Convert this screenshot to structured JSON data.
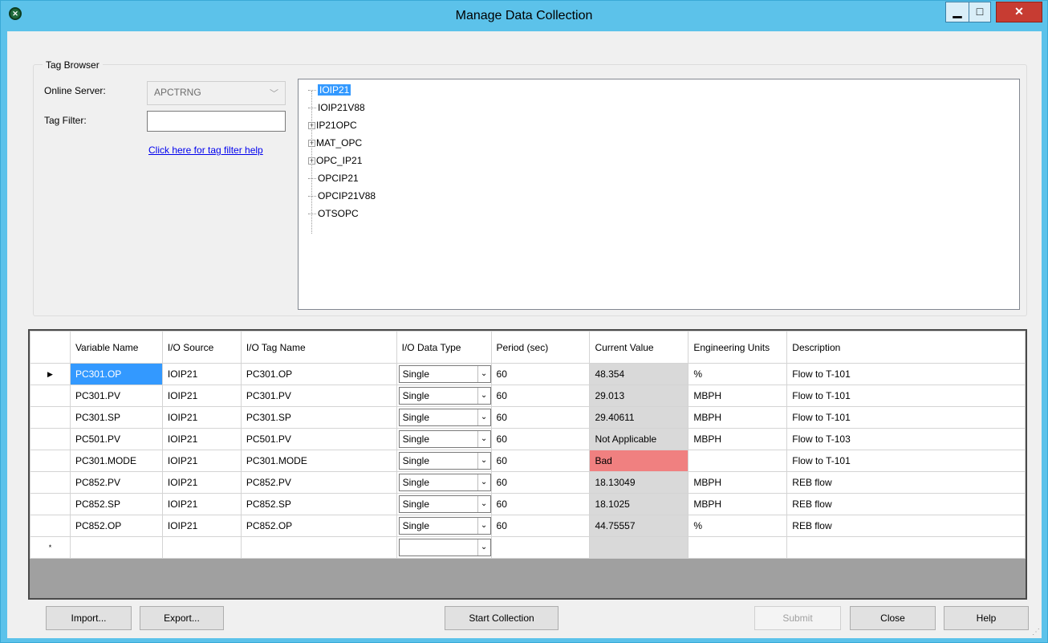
{
  "window": {
    "title": "Manage Data Collection",
    "icon_name": "app-icon"
  },
  "tag_browser": {
    "group_title": "Tag Browser",
    "online_server_label": "Online Server:",
    "online_server_value": "APCTRNG",
    "tag_filter_label": "Tag Filter:",
    "tag_filter_value": "",
    "help_link": "Click here for tag filter help",
    "tree": [
      {
        "label": "IOIP21",
        "expandable": false,
        "selected": true
      },
      {
        "label": "IOIP21V88",
        "expandable": false,
        "selected": false
      },
      {
        "label": "IP21OPC",
        "expandable": true,
        "selected": false
      },
      {
        "label": "MAT_OPC",
        "expandable": true,
        "selected": false
      },
      {
        "label": "OPC_IP21",
        "expandable": true,
        "selected": false
      },
      {
        "label": "OPCIP21",
        "expandable": false,
        "selected": false
      },
      {
        "label": "OPCIP21V88",
        "expandable": false,
        "selected": false
      },
      {
        "label": "OTSOPC",
        "expandable": false,
        "selected": false
      }
    ]
  },
  "grid": {
    "columns": [
      "Variable Name",
      "I/O Source",
      "I/O Tag Name",
      "I/O Data Type",
      "Period (sec)",
      "Current Value",
      "Engineering Units",
      "Description"
    ],
    "rows": [
      {
        "var": "PC301.OP",
        "src": "IOIP21",
        "tag": "PC301.OP",
        "type": "Single",
        "period": "60",
        "value": "48.354",
        "units": "%",
        "desc": "Flow to T-101",
        "status": "ok"
      },
      {
        "var": "PC301.PV",
        "src": "IOIP21",
        "tag": "PC301.PV",
        "type": "Single",
        "period": "60",
        "value": "29.013",
        "units": "MBPH",
        "desc": "Flow to T-101",
        "status": "ok"
      },
      {
        "var": "PC301.SP",
        "src": "IOIP21",
        "tag": "PC301.SP",
        "type": "Single",
        "period": "60",
        "value": "29.40611",
        "units": "MBPH",
        "desc": "Flow to T-101",
        "status": "ok"
      },
      {
        "var": "PC501.PV",
        "src": "IOIP21",
        "tag": "PC501.PV",
        "type": "Single",
        "period": "60",
        "value": "Not Applicable",
        "units": "MBPH",
        "desc": "Flow to T-103",
        "status": "ok"
      },
      {
        "var": "PC301.MODE",
        "src": "IOIP21",
        "tag": "PC301.MODE",
        "type": "Single",
        "period": "60",
        "value": "Bad",
        "units": "",
        "desc": "Flow to T-101",
        "status": "bad"
      },
      {
        "var": "PC852.PV",
        "src": "IOIP21",
        "tag": "PC852.PV",
        "type": "Single",
        "period": "60",
        "value": "18.13049",
        "units": "MBPH",
        "desc": "REB flow",
        "status": "ok"
      },
      {
        "var": "PC852.SP",
        "src": "IOIP21",
        "tag": "PC852.SP",
        "type": "Single",
        "period": "60",
        "value": "18.1025",
        "units": "MBPH",
        "desc": "REB flow",
        "status": "ok"
      },
      {
        "var": "PC852.OP",
        "src": "IOIP21",
        "tag": "PC852.OP",
        "type": "Single",
        "period": "60",
        "value": "44.75557",
        "units": "%",
        "desc": "REB flow",
        "status": "ok"
      }
    ],
    "new_row_marker": "*",
    "current_row_marker": "▶"
  },
  "buttons": {
    "import": "Import...",
    "export": "Export...",
    "start": "Start Collection",
    "submit": "Submit",
    "close": "Close",
    "help": "Help"
  },
  "colors": {
    "titlebar": "#5cc2ea",
    "bad_value": "#f08080",
    "selection": "#3399ff"
  }
}
